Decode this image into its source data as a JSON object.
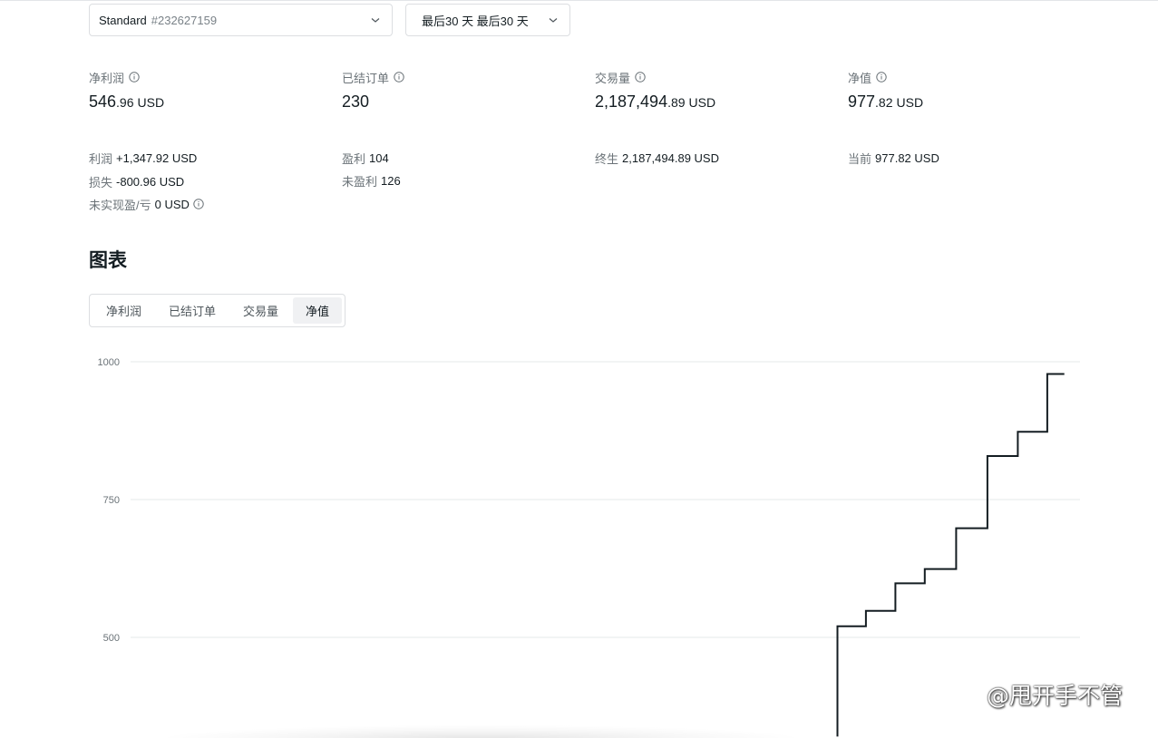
{
  "account_select": {
    "type": "Standard",
    "number": "#232627159"
  },
  "range_select": {
    "label": "最后30 天 最后30 天"
  },
  "stats": [
    {
      "label": "净利润",
      "int": "546",
      "frac": ".96",
      "currency": "USD"
    },
    {
      "label": "已结订单",
      "int": "230",
      "frac": "",
      "currency": ""
    },
    {
      "label": "交易量",
      "int": "2,187,494",
      "frac": ".89",
      "currency": "USD"
    },
    {
      "label": "净值",
      "int": "977",
      "frac": ".82",
      "currency": "USD"
    }
  ],
  "details": {
    "profit": {
      "label": "利润",
      "value": "+1,347.92 USD"
    },
    "loss": {
      "label": "损失",
      "value": "-800.96 USD"
    },
    "unrealized": {
      "label": "未实现盈/亏",
      "value": "0 USD"
    },
    "wins": {
      "label": "盈利",
      "value": "104"
    },
    "losses": {
      "label": "未盈利",
      "value": "126"
    },
    "lifetime": {
      "label": "终生",
      "value": "2,187,494.89 USD"
    },
    "current": {
      "label": "当前",
      "value": "977.82 USD"
    }
  },
  "chart_section": {
    "heading": "图表",
    "tabs": [
      "净利润",
      "已结订单",
      "交易量",
      "净值"
    ],
    "active_tab": "净值"
  },
  "chart_data": {
    "type": "line",
    "title": "",
    "xlabel": "",
    "ylabel": "",
    "yticks": [
      "1000",
      "750",
      "500"
    ],
    "ylim": [
      320,
      1000
    ],
    "grid": true,
    "line_color": "#141d22",
    "steps": [
      {
        "x": 0.7445,
        "y": 320
      },
      {
        "x": 0.7445,
        "y": 520
      },
      {
        "x": 0.7745,
        "y": 520
      },
      {
        "x": 0.7745,
        "y": 548
      },
      {
        "x": 0.8055,
        "y": 548
      },
      {
        "x": 0.8055,
        "y": 598
      },
      {
        "x": 0.8365,
        "y": 598
      },
      {
        "x": 0.8365,
        "y": 624
      },
      {
        "x": 0.8695,
        "y": 624
      },
      {
        "x": 0.8695,
        "y": 698
      },
      {
        "x": 0.9025,
        "y": 698
      },
      {
        "x": 0.9025,
        "y": 829
      },
      {
        "x": 0.9345,
        "y": 829
      },
      {
        "x": 0.9345,
        "y": 873
      },
      {
        "x": 0.9655,
        "y": 873
      },
      {
        "x": 0.9655,
        "y": 977.82
      },
      {
        "x": 0.9835,
        "y": 977.82
      }
    ]
  },
  "watermark": {
    "text": "@甩开手不管",
    "icon": "zhihu-icon"
  }
}
